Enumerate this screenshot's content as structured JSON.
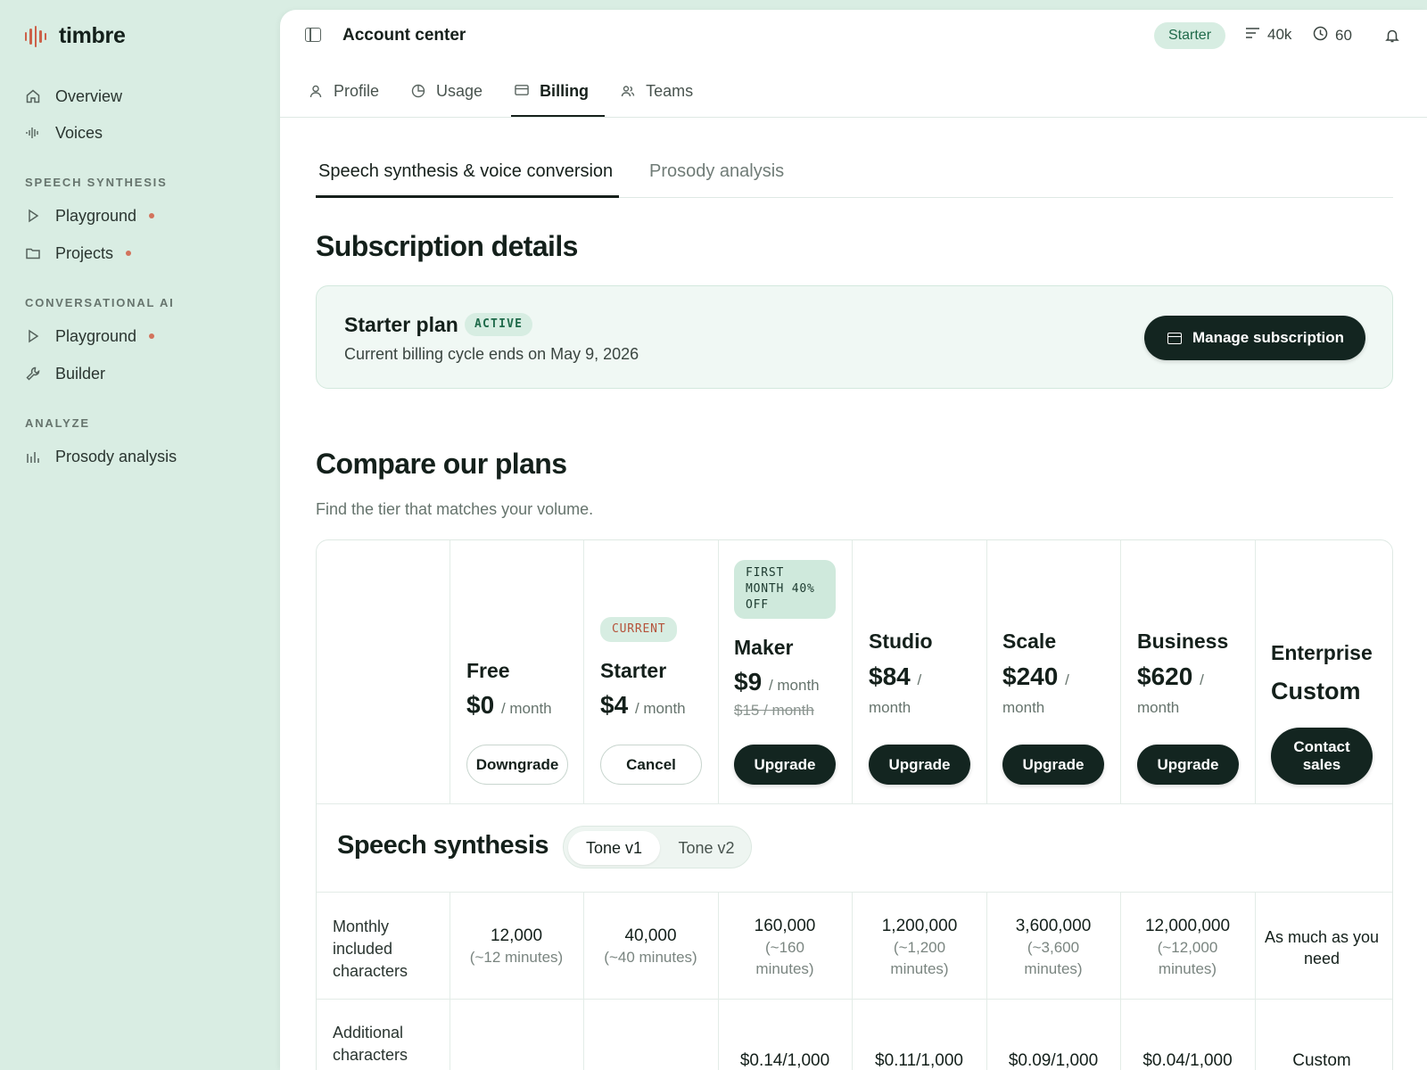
{
  "brand": {
    "name": "timbre"
  },
  "sidebar": {
    "top_items": [
      {
        "label": "Overview",
        "icon": "home-icon"
      },
      {
        "label": "Voices",
        "icon": "waveform-icon"
      }
    ],
    "sections": [
      {
        "title": "SPEECH SYNTHESIS",
        "items": [
          {
            "label": "Playground",
            "icon": "play-icon",
            "dot": true
          },
          {
            "label": "Projects",
            "icon": "folder-icon",
            "dot": true
          }
        ]
      },
      {
        "title": "CONVERSATIONAL AI",
        "items": [
          {
            "label": "Playground",
            "icon": "play-icon",
            "dot": true
          },
          {
            "label": "Builder",
            "icon": "wrench-icon",
            "dot": false
          }
        ]
      },
      {
        "title": "ANALYZE",
        "items": [
          {
            "label": "Prosody analysis",
            "icon": "bar-chart-icon",
            "dot": false
          }
        ]
      }
    ]
  },
  "header": {
    "title": "Account center",
    "plan_pill": "Starter",
    "characters": "40k",
    "minutes": "60"
  },
  "tabs": [
    {
      "label": "Profile",
      "icon": "user-icon",
      "active": false
    },
    {
      "label": "Usage",
      "icon": "clock-pie-icon",
      "active": false
    },
    {
      "label": "Billing",
      "icon": "credit-card-icon",
      "active": true
    },
    {
      "label": "Teams",
      "icon": "users-icon",
      "active": false
    }
  ],
  "subtabs": [
    {
      "label": "Speech synthesis & voice conversion",
      "active": true
    },
    {
      "label": "Prosody analysis",
      "active": false
    }
  ],
  "subscription": {
    "heading": "Subscription details",
    "plan_name": "Starter plan",
    "status": "ACTIVE",
    "cycle_text": "Current billing cycle ends on May 9, 2026",
    "manage_label": "Manage subscription"
  },
  "compare": {
    "heading": "Compare our plans",
    "subheading": "Find the tier that matches your volume."
  },
  "plans": [
    {
      "name": "Free",
      "price": "$0",
      "per": "/ month",
      "button": "Downgrade",
      "style": "outline"
    },
    {
      "name": "Starter",
      "price": "$4",
      "per": "/ month",
      "button": "Cancel",
      "style": "outline",
      "tag": "CURRENT"
    },
    {
      "name": "Maker",
      "price": "$9",
      "per": "/ month",
      "strike": "$15 / month",
      "button": "Upgrade",
      "style": "dark",
      "promo": "FIRST MONTH 40% OFF"
    },
    {
      "name": "Studio",
      "price": "$84",
      "per": "/",
      "per2": "month",
      "button": "Upgrade",
      "style": "dark"
    },
    {
      "name": "Scale",
      "price": "$240",
      "per": "/",
      "per2": "month",
      "button": "Upgrade",
      "style": "dark"
    },
    {
      "name": "Business",
      "price": "$620",
      "per": "/",
      "per2": "month",
      "button": "Upgrade",
      "style": "dark"
    },
    {
      "name": "Enterprise",
      "price": "Custom",
      "button": "Contact sales",
      "style": "dark"
    }
  ],
  "speech_synthesis": {
    "title": "Speech synthesis",
    "toggle": [
      "Tone v1",
      "Tone v2"
    ],
    "rows": [
      {
        "label": "Monthly included characters",
        "values": [
          {
            "main": "12,000",
            "sub": "(~12 minutes)"
          },
          {
            "main": "40,000",
            "sub": "(~40 minutes)"
          },
          {
            "main": "160,000",
            "sub": "(~160 minutes)"
          },
          {
            "main": "1,200,000",
            "sub": "(~1,200 minutes)"
          },
          {
            "main": "3,600,000",
            "sub": "(~3,600 minutes)"
          },
          {
            "main": "12,000,000",
            "sub": "(~12,000 minutes)"
          },
          {
            "main": "As much as you need",
            "sub": ""
          }
        ]
      },
      {
        "label": "Additional characters",
        "values": [
          {
            "main": "",
            "sub": ""
          },
          {
            "main": "",
            "sub": ""
          },
          {
            "main": "$0.14/1,000",
            "sub": ""
          },
          {
            "main": "$0.11/1,000",
            "sub": ""
          },
          {
            "main": "$0.09/1,000",
            "sub": ""
          },
          {
            "main": "$0.04/1,000",
            "sub": ""
          },
          {
            "main": "Custom",
            "sub": ""
          }
        ]
      }
    ]
  }
}
